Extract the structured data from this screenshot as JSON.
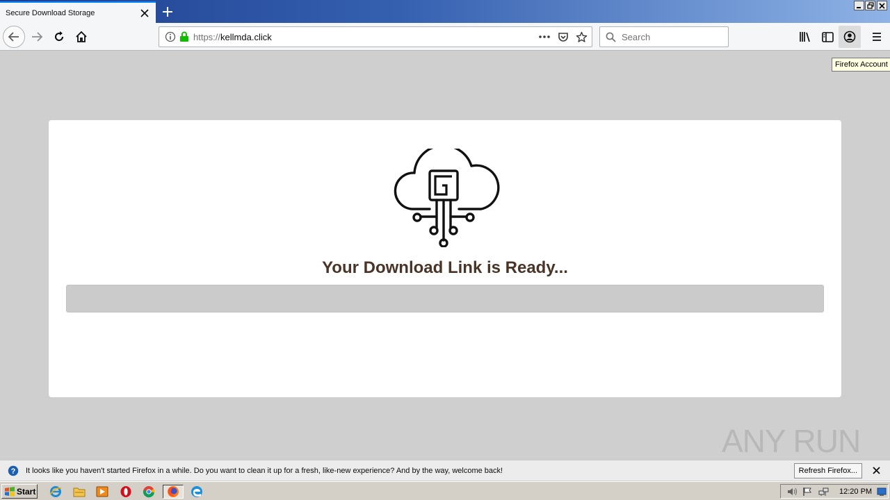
{
  "browser": {
    "tab_title": "Secure Download Storage",
    "url_protocol": "https://",
    "url_host": "kellmda.click",
    "search_placeholder": "Search",
    "tooltip": "Firefox Account"
  },
  "page": {
    "headline": "Your Download Link is Ready...",
    "progress_fraction": 0.0,
    "watermark": "ANY RUN"
  },
  "notification": {
    "message": "It looks like you haven't started Firefox in a while. Do you want to clean it up for a fresh, like-new experience? And by the way, welcome back!",
    "button_label": "Refresh Firefox..."
  },
  "taskbar": {
    "start_label": "Start",
    "clock": "12:20 PM",
    "apps": [
      "ie-icon",
      "explorer-icon",
      "media-player-icon",
      "opera-icon",
      "chrome-icon",
      "firefox-icon",
      "edge-icon"
    ]
  },
  "colors": {
    "headline": "#4a3427",
    "accent": "#0a84ff",
    "page_bg": "#cfcfcf"
  }
}
